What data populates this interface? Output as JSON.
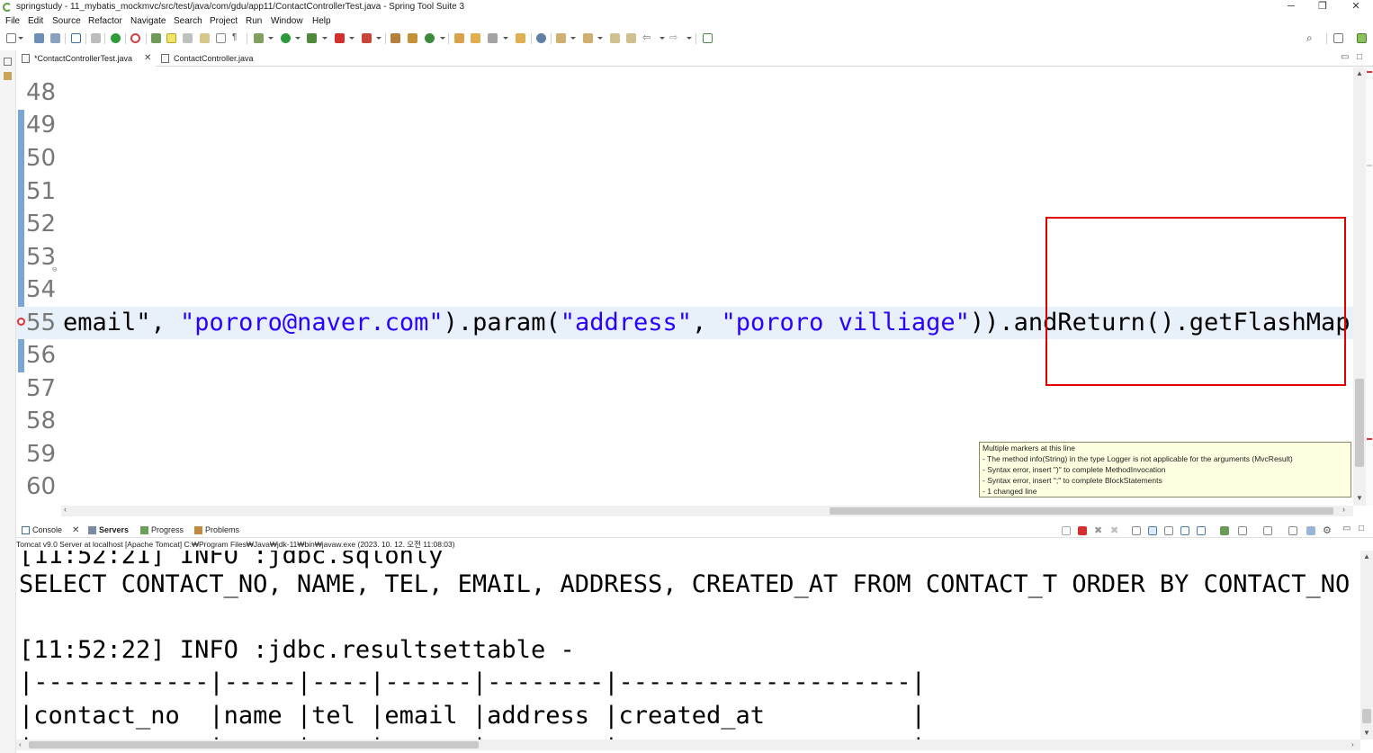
{
  "window": {
    "title": "springstudy - 11_mybatis_mockmvc/src/test/java/com/gdu/app11/ContactControllerTest.java - Spring Tool Suite 3",
    "minimize": "─",
    "restore": "❐",
    "close": "✕"
  },
  "menu": [
    "File",
    "Edit",
    "Source",
    "Refactor",
    "Navigate",
    "Search",
    "Project",
    "Run",
    "Window",
    "Help"
  ],
  "editor_tabs": [
    {
      "label": "*ContactControllerTest.java",
      "active": true,
      "close": "✕"
    },
    {
      "label": "ContactController.java",
      "active": false
    }
  ],
  "editor": {
    "lines": [
      {
        "no": "48",
        "code": ""
      },
      {
        "no": "49",
        "code": ""
      },
      {
        "no": "50",
        "code": ""
      },
      {
        "no": "51",
        "code": ""
      },
      {
        "no": "52",
        "code": ""
      },
      {
        "no": "53",
        "code": ""
      },
      {
        "no": "54",
        "code": ""
      },
      {
        "no": "55",
        "code_a": "email\", ",
        "code_s1": "\"pororo@naver.com\"",
        "code_b": ").param(",
        "code_s2": "\"address\"",
        "code_c": ", ",
        "code_s3": "\"pororo villiage\"",
        "code_d": ")).andReturn().getFlashMap()"
      },
      {
        "no": "56",
        "code": ""
      },
      {
        "no": "57",
        "code": ""
      },
      {
        "no": "58",
        "code": ""
      },
      {
        "no": "59",
        "code": ""
      },
      {
        "no": "60",
        "code": ""
      }
    ],
    "tooltip": [
      "Multiple markers at this line",
      "  - The method info(String) in the type Logger is not applicable for the arguments (MvcResult)",
      "  - Syntax error, insert \")\" to complete MethodInvocation",
      "  - Syntax error, insert \";\" to complete BlockStatements",
      "  - 1 changed line"
    ]
  },
  "console_tabs": [
    {
      "label": "Console",
      "close": "✕",
      "bold": false
    },
    {
      "label": "Servers",
      "bold": true
    },
    {
      "label": "Progress",
      "bold": false
    },
    {
      "label": "Problems",
      "bold": false
    }
  ],
  "console": {
    "description": "Tomcat v9.0 Server at localhost [Apache Tomcat] C:₩Program Files₩Java₩jdk-11₩bin₩javaw.exe  (2023. 10. 12. 오전 11:08:03)",
    "lines": [
      "[11:52:21] INFO :jdbc.sqlonly",
      "SELECT CONTACT_NO, NAME, TEL, EMAIL, ADDRESS, CREATED_AT FROM CONTACT_T ORDER BY CONTACT_NO ASC",
      "",
      "[11:52:22] INFO :jdbc.resultsettable -",
      "|------------|-----|----|------|--------|--------------------|",
      "|contact_no  |name |tel |email |address |created_at          |",
      "|------------|-----|----|------|--------|--------------------|"
    ]
  },
  "colors": {
    "highlight_box": "#e00000",
    "string_literal": "#2a00ff",
    "line_highlight": "#e8f0fa",
    "tooltip_bg": "#ffffe1"
  }
}
